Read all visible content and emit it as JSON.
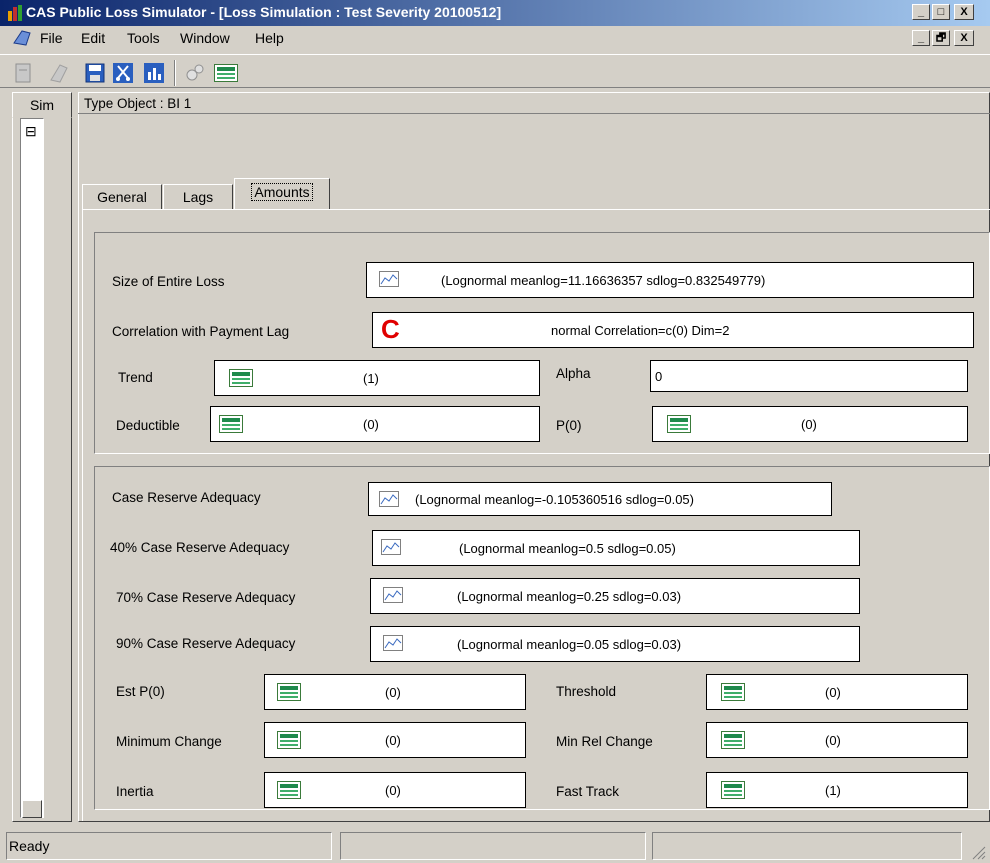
{
  "window": {
    "title": "CAS Public Loss Simulator - [Loss Simulation : Test Severity 20100512]",
    "min_glyph": "_",
    "max_glyph": "□",
    "restore_glyph": "🗗",
    "close_glyph": "X"
  },
  "menu": [
    "File",
    "Edit",
    "Tools",
    "Window",
    "Help"
  ],
  "toolbar": [
    "new-icon",
    "open-icon",
    "save-icon",
    "cut-icon",
    "chart-icon",
    "gears-icon",
    "sheet-icon"
  ],
  "left_panel": {
    "tab_label": "Sim",
    "tree_toggle": "⊟"
  },
  "type_object": "Type Object : BI 1",
  "tabs": [
    "General",
    "Lags",
    "Amounts"
  ],
  "active_tab": "Amounts",
  "group1": {
    "size_label": "Size of Entire Loss",
    "size_value": "(Lognormal meanlog=11.16636357  sdlog=0.832549779)",
    "corr_label": "Correlation with Payment Lag",
    "corr_icon": "C",
    "corr_value": "normal Correlation=c(0) Dim=2",
    "trend_label": "Trend",
    "trend_value": "(1)",
    "alpha_label": "Alpha",
    "alpha_value": "0",
    "deductible_label": "Deductible",
    "deductible_value": "(0)",
    "p0_label": "P(0)",
    "p0_value": "(0)"
  },
  "group2": {
    "case_label": "Case Reserve Adequacy",
    "case_value": "(Lognormal meanlog=-0.105360516  sdlog=0.05)",
    "case40_label": "40% Case Reserve Adequacy",
    "case40_value": "(Lognormal meanlog=0.5  sdlog=0.05)",
    "case70_label": "70% Case Reserve Adequacy",
    "case70_value": "(Lognormal meanlog=0.25  sdlog=0.03)",
    "case90_label": "90% Case Reserve Adequacy",
    "case90_value": "(Lognormal meanlog=0.05  sdlog=0.03)",
    "estp0_label": "Est P(0)",
    "estp0_value": "(0)",
    "threshold_label": "Threshold",
    "threshold_value": "(0)",
    "minchange_label": "Minimum Change",
    "minchange_value": "(0)",
    "minrel_label": "Min Rel Change",
    "minrel_value": "(0)",
    "inertia_label": "Inertia",
    "inertia_value": "(0)",
    "fasttrack_label": "Fast Track",
    "fasttrack_value": "(1)"
  },
  "status": {
    "text": "Ready"
  }
}
